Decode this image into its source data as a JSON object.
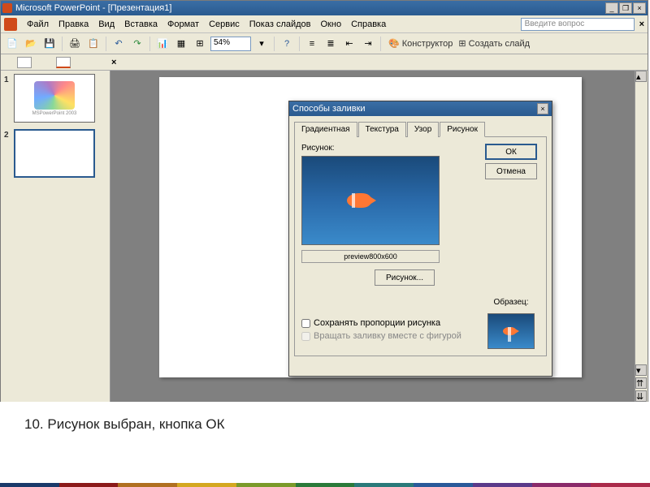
{
  "titlebar": {
    "app": "Microsoft PowerPoint",
    "doc": "[Презентация1]"
  },
  "menu": {
    "file": "Файл",
    "edit": "Правка",
    "view": "Вид",
    "insert": "Вставка",
    "format": "Формат",
    "tools": "Сервис",
    "slideshow": "Показ слайдов",
    "window": "Окно",
    "help": "Справка",
    "helpbox": "Введите вопрос"
  },
  "toolbar": {
    "zoom": "54%",
    "konstruktor": "Конструктор",
    "newslide": "Создать слайд"
  },
  "thumbs": {
    "n1": "1",
    "n2": "2",
    "caption1": "MSPowerPoint 2003"
  },
  "dialog": {
    "title": "Способы заливки",
    "tabs": {
      "grad": "Градиентная",
      "tex": "Текстура",
      "pat": "Узор",
      "pic": "Рисунок"
    },
    "picLabel": "Рисунок:",
    "previewName": "preview800x600",
    "picBtn": "Рисунок...",
    "ok": "ОК",
    "cancel": "Отмена",
    "sample": "Образец:",
    "chk1": "Сохранять пропорции рисунка",
    "chk2": "Вращать заливку вместе с фигурой"
  },
  "caption": "10.   Рисунок выбран, кнопка ОК",
  "stripColors": [
    "#1a3a6a",
    "#8b1a1a",
    "#b07020",
    "#d4a820",
    "#7a9a2a",
    "#2a7a3a",
    "#2a7a7a",
    "#2a5a9a",
    "#5a3a8a",
    "#8a2a6a",
    "#aa2a4a"
  ]
}
